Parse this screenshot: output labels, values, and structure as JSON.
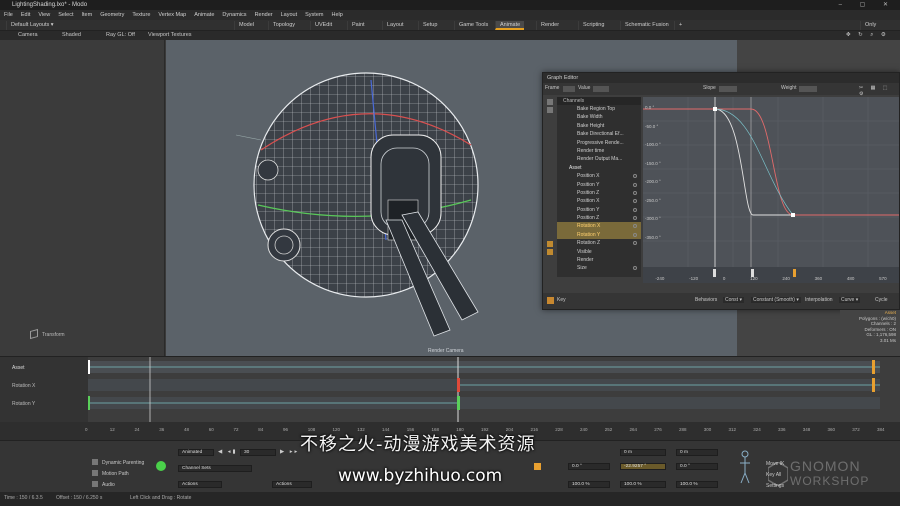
{
  "window": {
    "title": "LightingShading.lxo* - Modo"
  },
  "menu": [
    "File",
    "Edit",
    "View",
    "Select",
    "Item",
    "Geometry",
    "Texture",
    "Vertex Map",
    "Animate",
    "Dynamics",
    "Render",
    "Layout",
    "System",
    "Help"
  ],
  "layout_tabs": {
    "default_layouts": "Default Layouts ▾",
    "tabs": [
      "Model",
      "Topology",
      "UVEdit",
      "Paint",
      "Layout",
      "Setup",
      "Game Tools",
      "Animate",
      "Render",
      "Scripting",
      "Schematic Fusion"
    ],
    "active": "Animate",
    "only_label": "Only"
  },
  "viewport_bar": {
    "camera": "Camera",
    "shaded": "Shaded",
    "rayGL": "Ray GL: Off",
    "textures": "Viewport Textures"
  },
  "viewport": {
    "transform_label": "Transform",
    "render_camera_label": "Render Camera"
  },
  "graph_editor": {
    "title": "Graph Editor",
    "toolbar": {
      "frame": "Frame",
      "value": "Value",
      "slope": "Slope",
      "weight": "Weight"
    },
    "channels_header": "Channels",
    "channels": [
      {
        "label": "Bake Region Top",
        "type": "row"
      },
      {
        "label": "Bake Width",
        "type": "row"
      },
      {
        "label": "Bake Height",
        "type": "row"
      },
      {
        "label": "Bake Directional Ef...",
        "type": "row"
      },
      {
        "label": "Progressive Rende...",
        "type": "row"
      },
      {
        "label": "Render time",
        "type": "row"
      },
      {
        "label": "Render Output Ma...",
        "type": "row"
      },
      {
        "label": "Asset",
        "type": "grp"
      },
      {
        "label": "Position X",
        "type": "row"
      },
      {
        "label": "Position Y",
        "type": "row"
      },
      {
        "label": "Position Z",
        "type": "row"
      },
      {
        "label": "Position X",
        "type": "row"
      },
      {
        "label": "Position Y",
        "type": "row"
      },
      {
        "label": "Position Z",
        "type": "row"
      },
      {
        "label": "Rotation X",
        "type": "sel"
      },
      {
        "label": "Rotation Y",
        "type": "sel"
      },
      {
        "label": "Rotation Z",
        "type": "row"
      },
      {
        "label": "Visible",
        "type": "row"
      },
      {
        "label": "Render",
        "type": "row"
      },
      {
        "label": "Size",
        "type": "row"
      }
    ],
    "y_ticks": [
      "0.0 °",
      "-50.0 °",
      "-100.0 °",
      "-150.0 °",
      "-200.0 °",
      "-250.0 °",
      "-300.0 °",
      "-350.0 °",
      "-400.0 °",
      "-450.0 °"
    ],
    "x_ticks": [
      "-240",
      "-120",
      "0",
      "120",
      "240",
      "360",
      "480",
      "570"
    ],
    "bottom": {
      "key": "Key",
      "behaviors": "Behaviors",
      "behavior_val": "Const ▾",
      "interp_val": "Constant (Smooth) ▾",
      "interpolation": "Interpolation",
      "curve_val": "Curve ▾",
      "cycle": "Cycle"
    }
  },
  "info_panel": {
    "lines": [
      "Asset",
      "Polygons : (w/ch0)",
      "Channels : 2",
      "Deformers : ON",
      "GL : 1,176,598",
      "3.01 Ms"
    ]
  },
  "timeline": {
    "tracks": [
      "Asset",
      "Rotation X",
      "Rotation Y"
    ],
    "ticks": [
      "0",
      "12",
      "24",
      "36",
      "48",
      "60",
      "72",
      "84",
      "96",
      "108",
      "120",
      "132",
      "144",
      "156",
      "168",
      "180",
      "192",
      "204",
      "216",
      "228",
      "240",
      "252",
      "264",
      "276",
      "288",
      "300",
      "312",
      "324",
      "336",
      "348",
      "360",
      "372",
      "384"
    ]
  },
  "bottom_bar": {
    "dynamic_parenting": "Dynamic Parenting",
    "motion_path": "Motion Path",
    "audio": "Audio",
    "animated": "Animated",
    "frame_value": "30",
    "channel_sets": "Channel Sets",
    "actions": "Actions",
    "actions2": "Actions",
    "rot_x": "0.0 °",
    "rot_y": "-22.9257 °",
    "rot_z": "0.0 °",
    "pos_x": "0 m",
    "pos_y": "0 m",
    "pos_z": "0 m",
    "scale_x": "100.0 %",
    "scale_y": "100.0 %",
    "scale_z": "100.0 %",
    "move_label": "Move IK",
    "key_all": "Key All",
    "settings": "Settings"
  },
  "status": {
    "time": "Time : 150 / 6.3.5",
    "offset": "Offset : 150 / 6.250 s",
    "hint": "Left Click and Drag : Rotate"
  },
  "watermark": {
    "line1": "不移之火-动漫游戏美术资源",
    "line2": "www.byzhihuo.com"
  },
  "logo": {
    "line1": "GNOMON",
    "line2": "WORKSHOP"
  }
}
